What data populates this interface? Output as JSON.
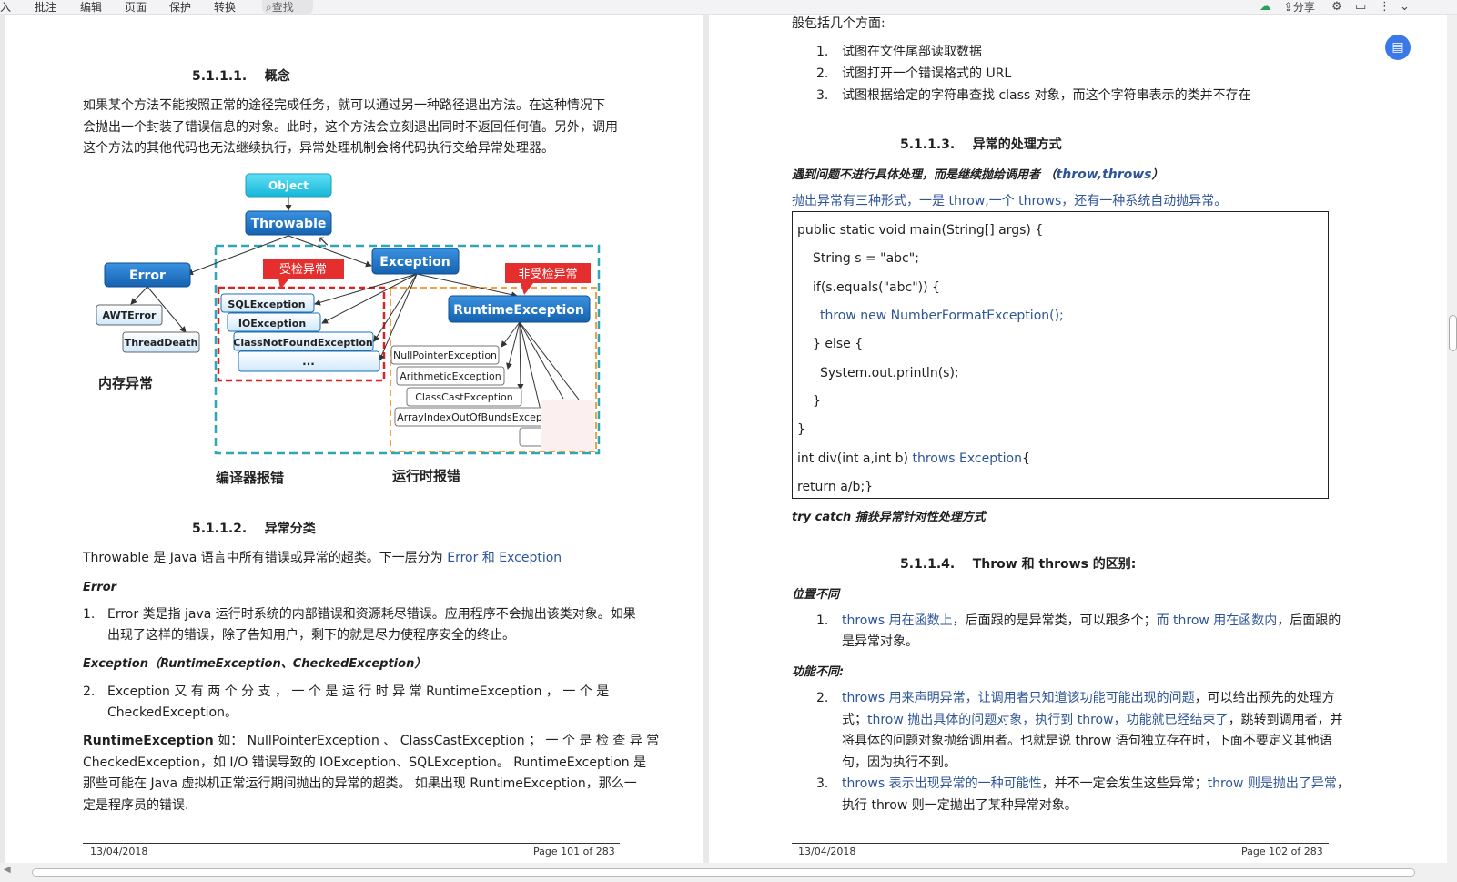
{
  "toolbar": {
    "tab_insert": "入",
    "tab_annotate": "批注",
    "tab_edit": "编辑",
    "tab_page": "页面",
    "tab_protect": "保护",
    "tab_convert": "转换",
    "search": "查找",
    "share": "分享"
  },
  "left": {
    "h1": "5.1.1.1.    概念",
    "p1_l1": "如果某个方法不能按照正常的途径完成任务，就可以通过另一种路径退出方法。在这种情况下",
    "p1_l2": "会抛出一个封装了错误信息的对象。此时，这个方法会立刻退出同时不返回任何值。另外，调用",
    "p1_l3": "这个方法的其他代码也无法继续执行，异常处理机制会将代码执行交给异常处理器。",
    "diagram": {
      "object": "Object",
      "throwable": "Throwable",
      "error": "Error",
      "exception": "Exception",
      "runtime": "RuntimeException",
      "awt": "AWTError",
      "thread": "ThreadDeath",
      "checked_tag": "受检异常",
      "unchecked_tag": "非受检异常",
      "sql": "SQLException",
      "io": "IOException",
      "cnf": "ClassNotFoundException",
      "dots": "...",
      "npe": "NullPointerException",
      "arith": "ArithmeticException",
      "cce": "ClassCastException",
      "aioobe": "ArrayIndexOutOfBundsExcep",
      "mem_label": "内存异常",
      "compile_label": "编译器报错",
      "runtime_label": "运行时报错"
    },
    "h2": "5.1.1.2.    异常分类",
    "p2_a": "Throwable 是 Java 语言中所有错误或异常的超类。下一层分为 ",
    "p2_b": "Error 和 Exception",
    "error_title": "Error",
    "li1_num": "1.",
    "li1_l1": "Error 类是指 java 运行时系统的内部错误和资源耗尽错误。应用程序不会抛出该类对象。如果",
    "li1_l2": "出现了这样的错误，除了告知用户，剩下的就是尽力使程序安全的终止。",
    "exc_title": "Exception（RuntimeException、CheckedException）",
    "li2_num": "2.",
    "li2_l1": "Exception  又 有 两 个 分 支 ， 一 个 是 运 行 时 异 常  RuntimeException ， 一 个 是",
    "li2_l2": "CheckedException。",
    "p3_b": "RuntimeException",
    "p3_l1": " 如： NullPointerException 、 ClassCastException ； 一 个 是 检 查 异 常",
    "p3_l2": "CheckedException，如 I/O 错误导致的 IOException、SQLException。 RuntimeException 是",
    "p3_l3": "那些可能在 Java 虚拟机正常运行期间抛出的异常的超类。 如果出现 RuntimeException，那么一",
    "p3_l4": "定是程序员的错误.",
    "footer_date": "13/04/2018",
    "footer_page": "Page 101 of 283"
  },
  "right": {
    "top_cut": "般包括几个方面:",
    "r1_num": "1.",
    "r1": "试图在文件尾部读取数据",
    "r2_num": "2.",
    "r2": "试图打开一个错误格式的 URL",
    "r3_num": "3.",
    "r3": "试图根据给定的字符串查找 class 对象，而这个字符串表示的类并不存在",
    "h3": "5.1.1.3.    异常的处理方式",
    "sub1_a": "遇到问题不进行具体处理，而是继续抛给调用者 （",
    "sub1_b": "throw,throws",
    "sub1_c": "）",
    "sub1_desc": "抛出异常有三种形式，一是 throw,一个 throws，还有一种系统自动抛异常。",
    "code": {
      "c1": "public static void main(String[] args) {",
      "c2": "String s = \"abc\";",
      "c3": "if(s.equals(\"abc\")) {",
      "c4": "throw new NumberFormatException();",
      "c5": "} else {",
      "c6": "System.out.println(s);",
      "c7": "}",
      "c8": "}",
      "c9_a": "int div(int a,int b) ",
      "c9_b": "throws Exception",
      "c9_c": "{",
      "c10": "return a/b;}"
    },
    "sub2": "try catch 捕获异常针对性处理方式",
    "h4": "5.1.1.4.    Throw 和 throws 的区别:",
    "pos_title": "位置不同",
    "p1_num": "1.",
    "p1_a": "throws 用在函数上",
    "p1_b": "，后面跟的是异常类，可以跟多个；",
    "p1_c": "而 throw 用在函数内",
    "p1_d": "，后面跟的",
    "p1_l2": "是异常对象。",
    "func_title": "功能不同:",
    "p2_num": "2.",
    "p2_a": "throws 用来声明异常，让调用者只知道该功能可能出现的问题",
    "p2_b": "，可以给出预先的处理方",
    "p2_c": "式；",
    "p2_d": "throw 抛出具体的问题对象，执行到 throw，功能就已经结束了",
    "p2_e": "，跳转到调用者，并",
    "p2_l3": "将具体的问题对象抛给调用者。也就是说 throw 语句独立存在时，下面不要定义其他语",
    "p2_l4": "句，因为执行不到。",
    "p3_num": "3.",
    "p3_a": "throws 表示出现异常的一种可能性",
    "p3_b": "，并不一定会发生这些异常；",
    "p3_c": "throw 则是抛出了异常",
    "p3_d": "，",
    "p3_l2": "执行 throw 则一定抛出了某种异常对象。",
    "footer_date": "13/04/2018",
    "footer_page": "Page 102 of 283"
  },
  "colors": {
    "link_blue": "#2e5597",
    "node_blue": "#1e73c8",
    "tag_red": "#e52e2e"
  }
}
